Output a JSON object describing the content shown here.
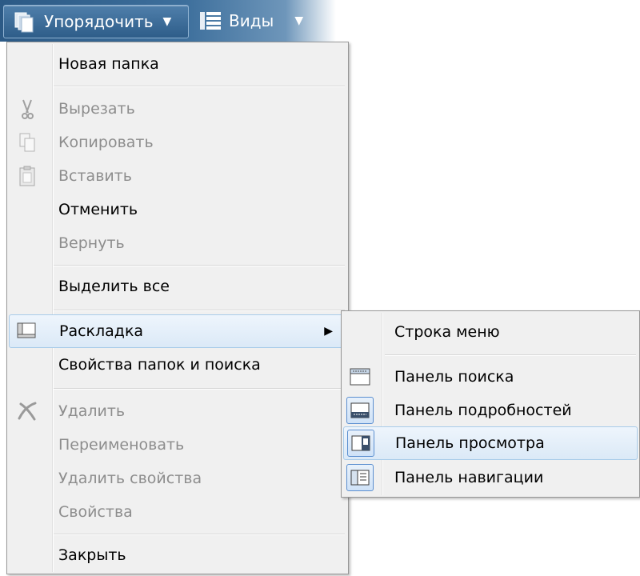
{
  "toolbar": {
    "organize_label": "Упорядочить",
    "organize_arrow": "▼",
    "views_label": "Виды",
    "views_arrow": "▼"
  },
  "menu": {
    "items": [
      {
        "label": "Новая папка",
        "enabled": true
      },
      {
        "label": "Вырезать",
        "enabled": false,
        "icon": "scissors-icon"
      },
      {
        "label": "Копировать",
        "enabled": false,
        "icon": "copy-icon"
      },
      {
        "label": "Вставить",
        "enabled": false,
        "icon": "paste-icon"
      },
      {
        "label": "Отменить",
        "enabled": true
      },
      {
        "label": "Вернуть",
        "enabled": false
      },
      {
        "label": "Выделить все",
        "enabled": true
      },
      {
        "label": "Раскладка",
        "enabled": true,
        "icon": "layout-icon",
        "submenu": true,
        "highlighted": true
      },
      {
        "label": "Свойства папок и поиска",
        "enabled": true
      },
      {
        "label": "Удалить",
        "enabled": false,
        "icon": "delete-icon"
      },
      {
        "label": "Переименовать",
        "enabled": false
      },
      {
        "label": "Удалить свойства",
        "enabled": false
      },
      {
        "label": "Свойства",
        "enabled": false
      },
      {
        "label": "Закрыть",
        "enabled": true
      }
    ],
    "submenu_arrow": "▶"
  },
  "submenu": {
    "items": [
      {
        "label": "Строка меню",
        "checked": false
      },
      {
        "label": "Панель поиска",
        "checked": false,
        "icon": "search-pane-icon"
      },
      {
        "label": "Панель подробностей",
        "checked": true,
        "icon": "details-pane-icon"
      },
      {
        "label": "Панель просмотра",
        "checked": true,
        "icon": "preview-pane-icon",
        "highlighted": true
      },
      {
        "label": "Панель навигации",
        "checked": true,
        "icon": "navigation-pane-icon"
      }
    ]
  },
  "colors": {
    "toolbar_bg": "#2c5a86",
    "menu_bg": "#f0f0f0",
    "highlight": "#dbe9f7",
    "disabled_text": "#8d8d8d"
  }
}
